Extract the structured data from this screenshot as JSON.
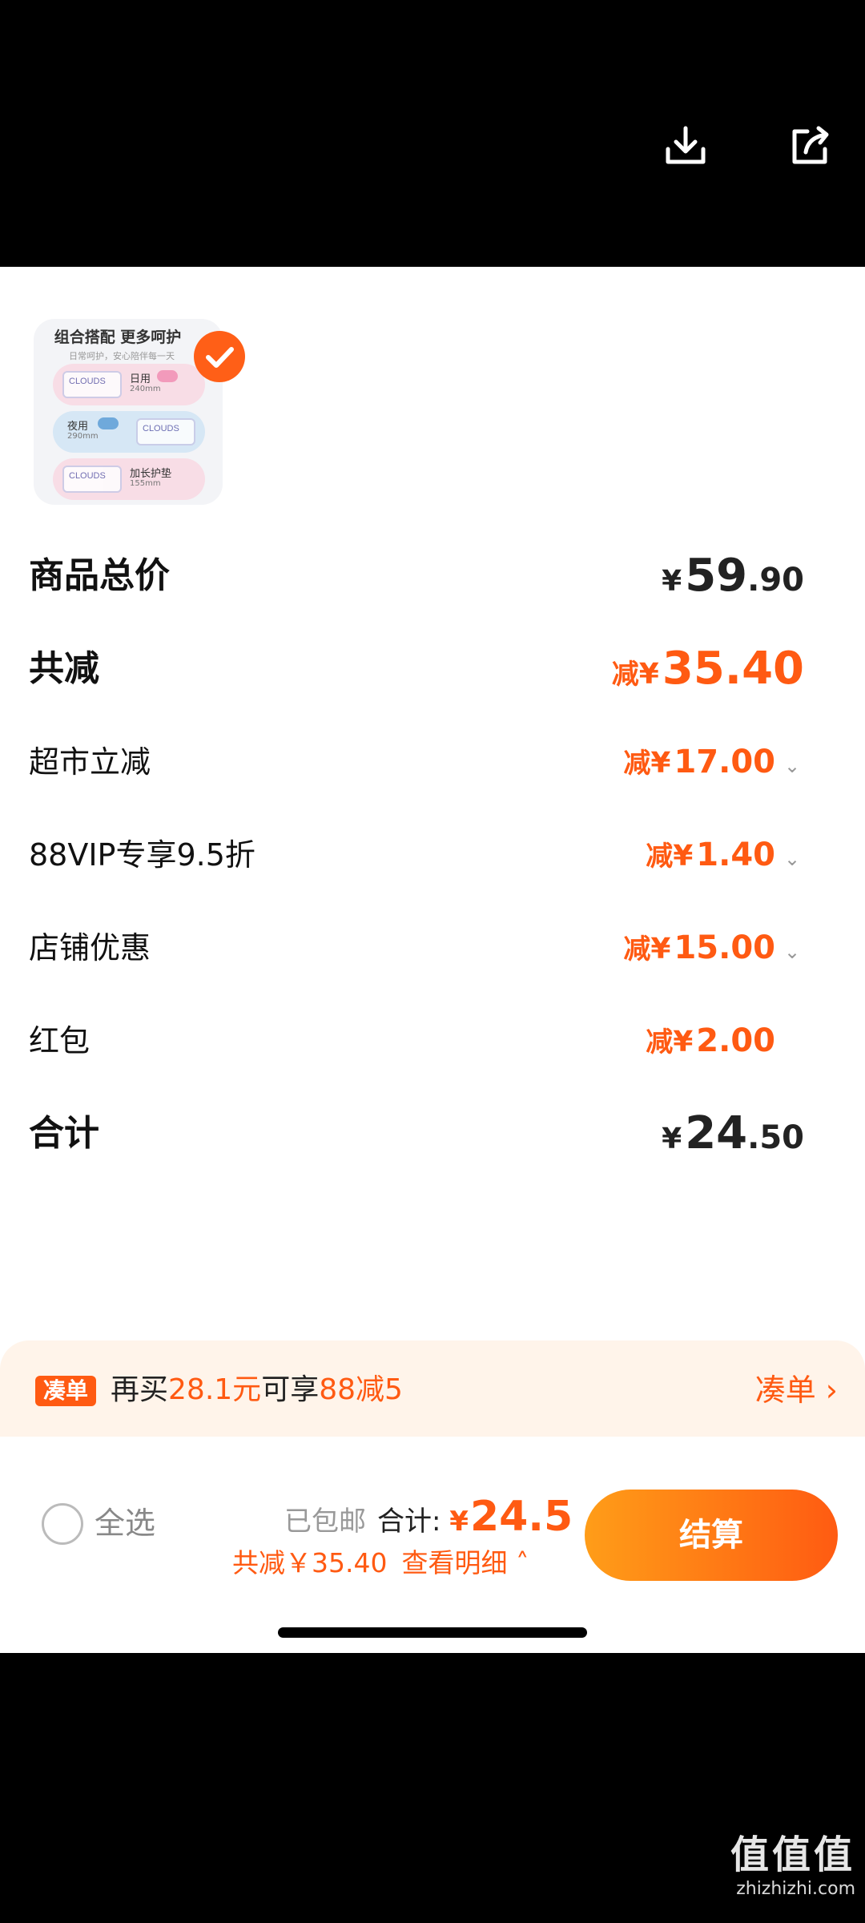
{
  "top_bar": {
    "download_icon": "download-icon",
    "share_icon": "share-icon"
  },
  "thumbnail": {
    "title": "组合搭配 更多呵护",
    "subtitle": "日常呵护，安心陪伴每一天",
    "items": [
      {
        "brand": "CLOUDS",
        "name": "日用",
        "spec": "240mm"
      },
      {
        "brand": "CLOUDS",
        "name": "夜用",
        "spec": "290mm"
      },
      {
        "brand": "CLOUDS",
        "name": "加长护垫",
        "spec": "155mm"
      }
    ],
    "selected_icon": "check-icon"
  },
  "summary": {
    "goods_total": {
      "label": "商品总价",
      "yen": "¥",
      "int": "59",
      "dec": ".90"
    },
    "total_discount": {
      "label": "共减",
      "prefix": "减",
      "yen": "¥",
      "amount": "35.40"
    },
    "discounts": [
      {
        "label": "超市立减",
        "prefix": "减",
        "yen": "¥",
        "amount": "17.00",
        "expandable": true
      },
      {
        "label": "88VIP专享9.5折",
        "prefix": "减",
        "yen": "¥",
        "amount": "1.40",
        "expandable": true
      },
      {
        "label": "店铺优惠",
        "prefix": "减",
        "yen": "¥",
        "amount": "15.00",
        "expandable": true
      },
      {
        "label": "红包",
        "prefix": "减",
        "yen": "¥",
        "amount": "2.00",
        "expandable": false
      }
    ],
    "grand_total": {
      "label": "合计",
      "yen": "¥",
      "int": "24",
      "dec": ".50"
    }
  },
  "promo": {
    "badge": "凑单",
    "text_before": "再买",
    "amount": "28.1元",
    "text_mid": "可享",
    "deal": "88减5",
    "link": "凑单"
  },
  "footer": {
    "select_all": "全选",
    "free_shipping": "已包邮",
    "total_label": "合计: ",
    "total_yen": "¥",
    "total_amount": "24.5",
    "discount_text": "共减￥35.40",
    "detail_link": "查看明细",
    "pay_button": "结算"
  },
  "watermark": {
    "big": "值值值",
    "small": "zhizhizhi.com"
  }
}
